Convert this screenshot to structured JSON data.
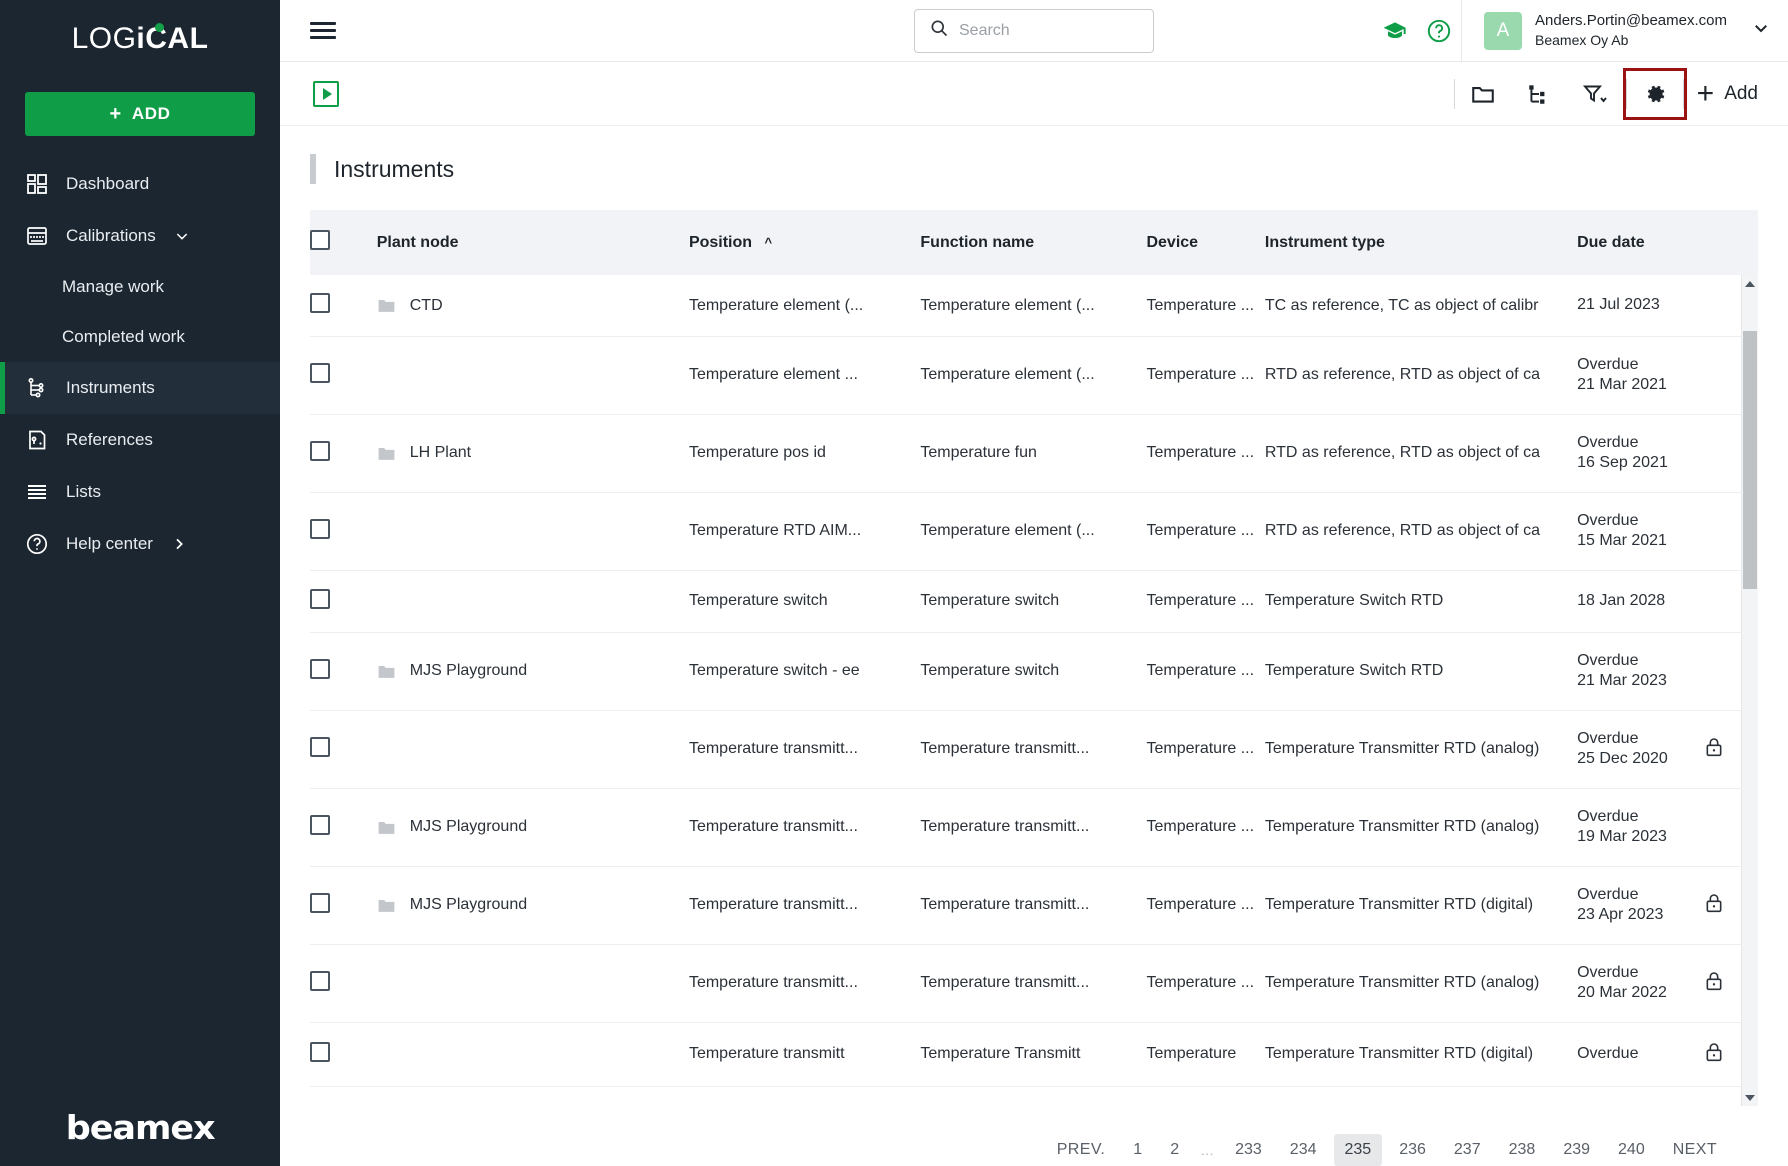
{
  "sidebar": {
    "logo_left": "LOG",
    "logo_i": "i",
    "logo_right": "CAL",
    "add_button": "ADD",
    "items": [
      {
        "label": "Dashboard",
        "icon": "dashboard-icon"
      },
      {
        "label": "Calibrations",
        "icon": "calibrations-icon"
      },
      {
        "label": "Instruments",
        "icon": "instruments-icon"
      },
      {
        "label": "References",
        "icon": "references-icon"
      },
      {
        "label": "Lists",
        "icon": "lists-icon"
      },
      {
        "label": "Help center",
        "icon": "help-circle-icon"
      }
    ],
    "sub_items": [
      {
        "label": "Manage work"
      },
      {
        "label": "Completed work"
      }
    ],
    "footer_logo": "beamex"
  },
  "header": {
    "search_placeholder": "Search",
    "search_value": "",
    "graduation_icon": "graduation-cap-icon",
    "help_icon": "help-circle-icon",
    "avatar_initial": "A",
    "user_email": "Anders.Portin@beamex.com",
    "user_org": "Beamex Oy Ab"
  },
  "toolbar": {
    "play_icon": "play-square-icon",
    "folder_icon": "folder-icon",
    "tree_icon": "hierarchy-icon",
    "filter_icon": "filter-icon",
    "settings_icon": "gear-icon",
    "add_label": "Add",
    "highlight_color": "#9b1212"
  },
  "page": {
    "title": "Instruments"
  },
  "table": {
    "columns": [
      "Plant node",
      "Position",
      "Function name",
      "Device",
      "Instrument type",
      "Due date"
    ],
    "sort_column": "Position",
    "sort_direction": "asc",
    "rows": [
      {
        "plant_node": "CTD",
        "has_folder": true,
        "position": "Temperature element (...",
        "function_name": "Temperature element (...",
        "device": "Temperature ...",
        "instrument_type": "TC as reference, TC as object of calibr",
        "due_overdue": "",
        "due_date": "21 Jul 2023",
        "locked": false
      },
      {
        "plant_node": "",
        "has_folder": false,
        "position": "Temperature element ...",
        "function_name": "Temperature element (...",
        "device": "Temperature ...",
        "instrument_type": "RTD as reference, RTD as object of ca",
        "due_overdue": "Overdue",
        "due_date": "21 Mar 2021",
        "locked": false
      },
      {
        "plant_node": "LH Plant",
        "has_folder": true,
        "position": "Temperature pos id",
        "function_name": "Temperature fun",
        "device": "Temperature ...",
        "instrument_type": "RTD as reference, RTD as object of ca",
        "due_overdue": "Overdue",
        "due_date": "16 Sep 2021",
        "locked": false
      },
      {
        "plant_node": "",
        "has_folder": false,
        "position": "Temperature RTD AIM...",
        "function_name": "Temperature element (...",
        "device": "Temperature ...",
        "instrument_type": "RTD as reference, RTD as object of ca",
        "due_overdue": "Overdue",
        "due_date": "15 Mar 2021",
        "locked": false
      },
      {
        "plant_node": "",
        "has_folder": false,
        "position": "Temperature switch",
        "function_name": "Temperature switch",
        "device": "Temperature ...",
        "instrument_type": "Temperature Switch RTD",
        "due_overdue": "",
        "due_date": "18 Jan 2028",
        "locked": false
      },
      {
        "plant_node": "MJS Playground",
        "has_folder": true,
        "position": "Temperature switch - ee",
        "function_name": "Temperature switch",
        "device": "Temperature ...",
        "instrument_type": "Temperature Switch RTD",
        "due_overdue": "Overdue",
        "due_date": "21 Mar 2023",
        "locked": false
      },
      {
        "plant_node": "",
        "has_folder": false,
        "position": "Temperature transmitt...",
        "function_name": "Temperature transmitt...",
        "device": "Temperature ...",
        "instrument_type": "Temperature Transmitter RTD (analog)",
        "due_overdue": "Overdue",
        "due_date": "25 Dec 2020",
        "locked": true
      },
      {
        "plant_node": "MJS Playground",
        "has_folder": true,
        "position": "Temperature transmitt...",
        "function_name": "Temperature transmitt...",
        "device": "Temperature ...",
        "instrument_type": "Temperature Transmitter RTD (analog)",
        "due_overdue": "Overdue",
        "due_date": "19 Mar 2023",
        "locked": false
      },
      {
        "plant_node": "MJS Playground",
        "has_folder": true,
        "position": "Temperature transmitt...",
        "function_name": "Temperature transmitt...",
        "device": "Temperature ...",
        "instrument_type": "Temperature Transmitter RTD (digital)",
        "due_overdue": "Overdue",
        "due_date": "23 Apr 2023",
        "locked": true
      },
      {
        "plant_node": "",
        "has_folder": false,
        "position": "Temperature transmitt...",
        "function_name": "Temperature transmitt...",
        "device": "Temperature ...",
        "instrument_type": "Temperature Transmitter RTD (analog)",
        "due_overdue": "Overdue",
        "due_date": "20 Mar 2022",
        "locked": true
      },
      {
        "plant_node": "",
        "has_folder": false,
        "position": "Temperature transmitt",
        "function_name": "Temperature Transmitt",
        "device": "Temperature",
        "instrument_type": "Temperature Transmitter RTD (digital)",
        "due_overdue": "Overdue",
        "due_date": "",
        "locked": true
      }
    ]
  },
  "pagination": {
    "prev_label": "PREV.",
    "next_label": "NEXT",
    "pages": [
      "1",
      "2",
      "…",
      "233",
      "234",
      "235",
      "236",
      "237",
      "238",
      "239",
      "240"
    ],
    "current": "235"
  },
  "colors": {
    "brand_green": "#0f9d47",
    "link_green": "#19a351",
    "sidebar_bg": "#1c2630",
    "highlight_red": "#9b1212"
  }
}
